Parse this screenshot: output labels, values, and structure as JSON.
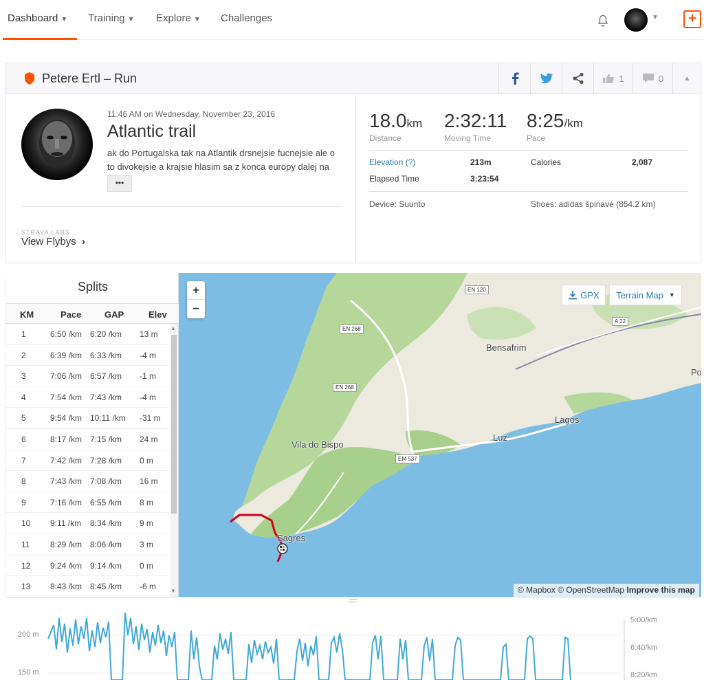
{
  "nav": {
    "items": [
      {
        "label": "Dashboard",
        "has_menu": true
      },
      {
        "label": "Training",
        "has_menu": true
      },
      {
        "label": "Explore",
        "has_menu": true
      },
      {
        "label": "Challenges",
        "has_menu": false
      }
    ],
    "accent": "#fc5200"
  },
  "activity": {
    "header_title": "Petere Ertl – Run",
    "kudos_count": "1",
    "comment_count": "0",
    "date_line": "11:46 AM on Wednesday, November 23, 2016",
    "name": "Atlantic trail",
    "description": "ak do Portugalska tak na Atlantik drsnejsie fucnejsie ale o to divokejsie a krajsie hlasim sa z konca europy dalej na zapad",
    "more_label": "•••",
    "labs_label": "STRAVA LABS",
    "flybys_label": "View Flybys",
    "flybys_arrow": "›"
  },
  "stats": {
    "distance": {
      "value": "18.0",
      "unit": "km",
      "label": "Distance"
    },
    "moving_time": {
      "value": "2:32:11",
      "label": "Moving Time"
    },
    "pace": {
      "value": "8:25",
      "unit": "/km",
      "label": "Pace"
    },
    "elevation_label": "Elevation (?)",
    "elevation_value": "213m",
    "calories_label": "Calories",
    "calories_value": "2,087",
    "elapsed_label": "Elapsed Time",
    "elapsed_value": "3:23:54",
    "device": "Device: Suunto",
    "shoes": "Shoes: adidas špinavé (854.2 km)"
  },
  "splits": {
    "title": "Splits",
    "columns": [
      "KM",
      "Pace",
      "GAP",
      "Elev"
    ],
    "rows": [
      [
        "1",
        "6:50 /km",
        "6:20 /km",
        "13 m"
      ],
      [
        "2",
        "6:39 /km",
        "6:33 /km",
        "-4 m"
      ],
      [
        "3",
        "7:06 /km",
        "6:57 /km",
        "-1 m"
      ],
      [
        "4",
        "7:54 /km",
        "7:43 /km",
        "-4 m"
      ],
      [
        "5",
        "9:54 /km",
        "10:11 /km",
        "-31 m"
      ],
      [
        "6",
        "8:17 /km",
        "7:15 /km",
        "24 m"
      ],
      [
        "7",
        "7:42 /km",
        "7:28 /km",
        "0 m"
      ],
      [
        "8",
        "7:43 /km",
        "7:08 /km",
        "16 m"
      ],
      [
        "9",
        "7:16 /km",
        "6:55 /km",
        "8 m"
      ],
      [
        "10",
        "9:11 /km",
        "8:34 /km",
        "9 m"
      ],
      [
        "11",
        "8:29 /km",
        "8:06 /km",
        "3 m"
      ],
      [
        "12",
        "9:24 /km",
        "9:14 /km",
        "0 m"
      ],
      [
        "13",
        "8:43 /km",
        "8:45 /km",
        "-6 m"
      ]
    ]
  },
  "map": {
    "gpx_label": "GPX",
    "terrain_label": "Terrain Map",
    "attribution": "© Mapbox © OpenStreetMap",
    "improve_label": "Improve this map",
    "places": [
      "Bensafrim",
      "Lagos",
      "Luz",
      "Vila do Bispo",
      "Sagres",
      "Po"
    ],
    "roads": [
      "EN 120",
      "A 22",
      "EN 268",
      "EN 268",
      "EM 537"
    ],
    "water_color": "#7dbde4",
    "land_color": "#ece9df",
    "green_color": "#a8d08d",
    "route_color": "#d0021b"
  },
  "elevation_chart": {
    "left_ticks": [
      "200 m",
      "150 m"
    ],
    "right_ticks": [
      "5:00/km",
      "6:40/km",
      "8:20/km"
    ],
    "line_color": "#3fa9d6"
  }
}
